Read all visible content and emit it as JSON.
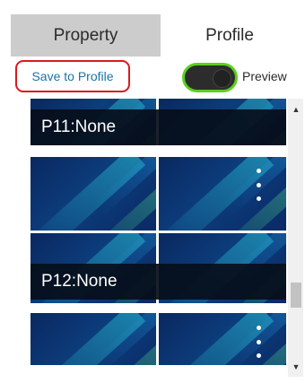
{
  "tabs": [
    {
      "label": "Property",
      "selected": false
    },
    {
      "label": "Profile",
      "selected": true
    }
  ],
  "toolbar": {
    "save_label": "Save to Profile",
    "preview_label": "Preview",
    "preview_on": true
  },
  "profiles": [
    {
      "caption": "P11:None"
    },
    {
      "caption": "P12:None"
    }
  ],
  "colors": {
    "accent_green": "#5ccf1e",
    "highlight_red": "#d81b1b",
    "link_blue": "#1a73a8",
    "tab_inactive": "#cccccc"
  },
  "icons": {
    "more": "kebab-vertical",
    "scroll_up": "triangle-up",
    "scroll_down": "triangle-down"
  }
}
